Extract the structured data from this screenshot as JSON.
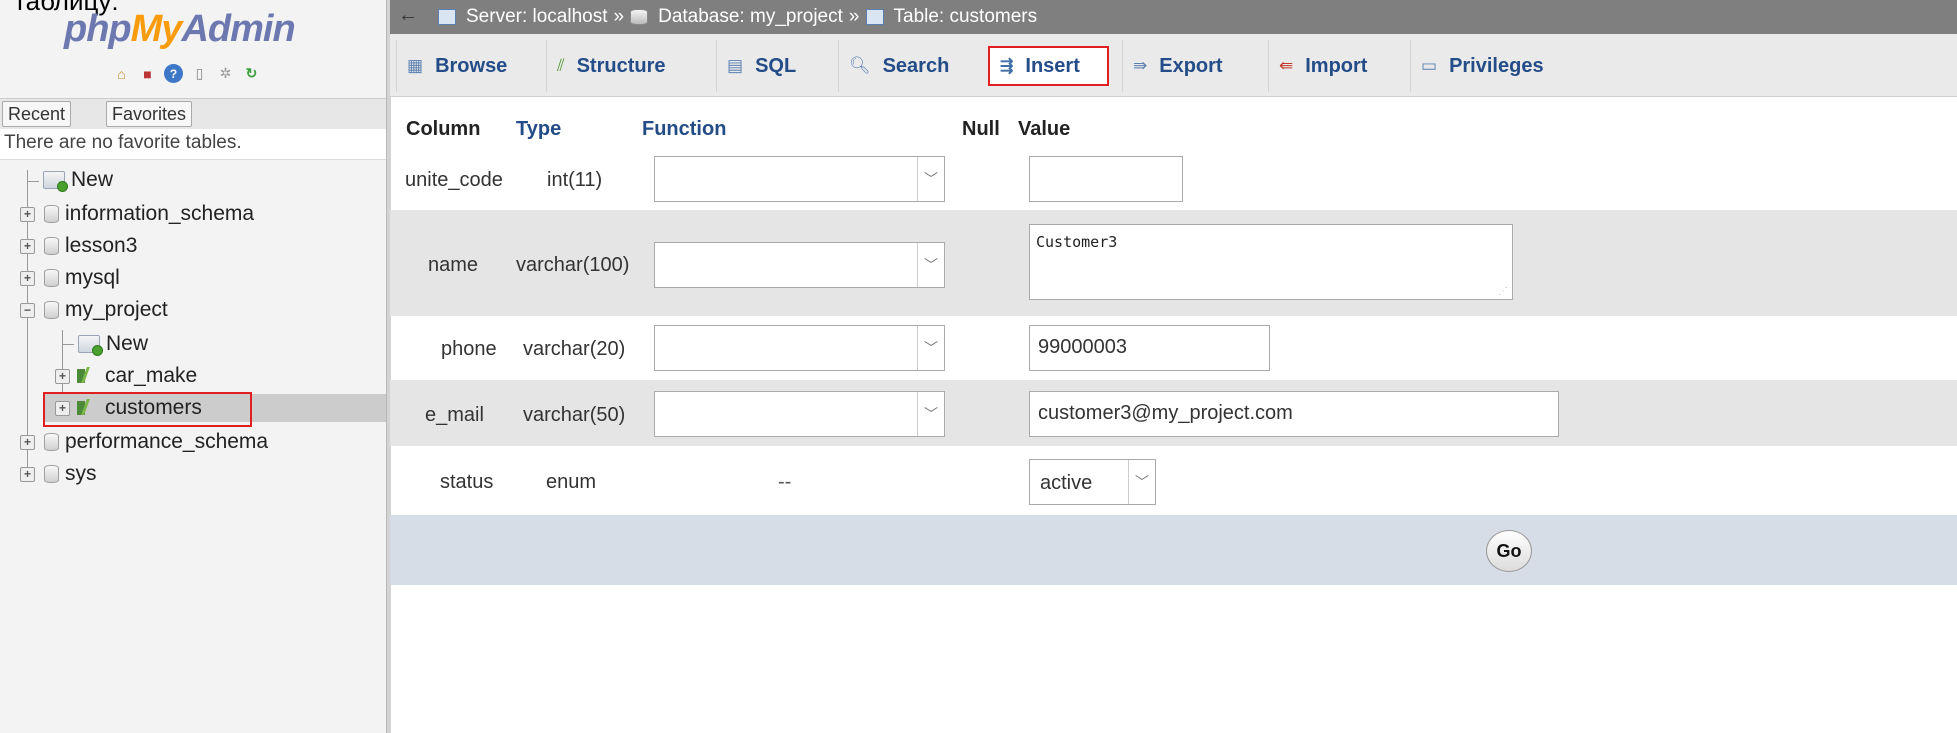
{
  "cut_text": "таблицу:",
  "logo": {
    "php": "php",
    "my": "My",
    "admin": "Admin"
  },
  "logo_icons": [
    "home-icon",
    "exit-icon",
    "help-icon",
    "docs-icon",
    "settings-icon",
    "reload-icon"
  ],
  "nav_tabs": {
    "recent": "Recent",
    "favorites": "Favorites"
  },
  "favorites_message": "There are no favorite tables.",
  "tree": {
    "new": "New",
    "information_schema": "information_schema",
    "lesson3": "lesson3",
    "mysql": "mysql",
    "my_project": "my_project",
    "my_project_new": "New",
    "car_make": "car_make",
    "customers": "customers",
    "performance_schema": "performance_schema",
    "sys": "sys"
  },
  "breadcrumb": {
    "back": "←",
    "server": "Server: localhost",
    "sep1": "»",
    "database": "Database: my_project",
    "sep2": "»",
    "table": "Table: customers"
  },
  "tabs": {
    "browse": "Browse",
    "structure": "Structure",
    "sql": "SQL",
    "search": "Search",
    "insert": "Insert",
    "export": "Export",
    "import": "Import",
    "privileges": "Privileges"
  },
  "active_tab": "Insert",
  "headers": {
    "column": "Column",
    "type": "Type",
    "function": "Function",
    "null": "Null",
    "value": "Value"
  },
  "rows": [
    {
      "column": "unite_code",
      "type": "int(11)",
      "value": ""
    },
    {
      "column": "name",
      "type": "varchar(100)",
      "value": "Customer3"
    },
    {
      "column": "phone",
      "type": "varchar(20)",
      "value": "99000003"
    },
    {
      "column": "e_mail",
      "type": "varchar(50)",
      "value": "customer3@my_project.com"
    },
    {
      "column": "status",
      "type": "enum",
      "function": "--",
      "value": "active"
    }
  ],
  "go_button": "Go"
}
